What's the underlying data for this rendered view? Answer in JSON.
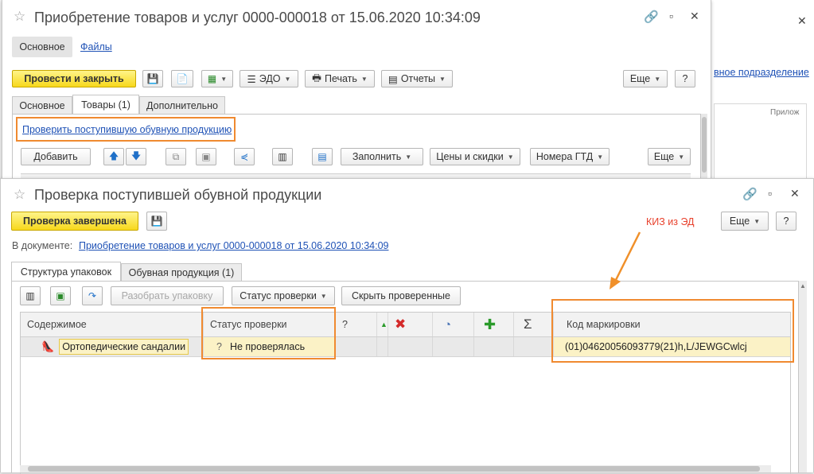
{
  "back_window": {
    "title": "Приобретение товаров и услуг 0000-000018 от 15.06.2020 10:34:09",
    "nav": {
      "main": "Основное",
      "files": "Файлы"
    },
    "toolbar": {
      "post_close": "Провести и закрыть",
      "edo": "ЭДО",
      "print": "Печать",
      "reports": "Отчеты",
      "more": "Еще",
      "help": "?"
    },
    "tabs": [
      "Основное",
      "Товары (1)",
      "Дополнительно"
    ],
    "check_link": "Проверить поступившую обувную продукцию",
    "goods_toolbar": {
      "add": "Добавить",
      "fill": "Заполнить",
      "prices": "Цены и скидки",
      "gtd": "Номера ГТД",
      "more": "Еще"
    }
  },
  "side_window": {
    "link_fragment": "вное подразделение",
    "column_fragment": "Прилож"
  },
  "front_window": {
    "title": "Проверка поступившей обувной продукции",
    "toolbar": {
      "done": "Проверка завершена",
      "more": "Еще",
      "help": "?"
    },
    "doc_label": "В документе:",
    "doc_link": "Приобретение товаров и услуг 0000-000018 от 15.06.2020 10:34:09",
    "tabs": [
      "Структура упаковок",
      "Обувная продукция (1)"
    ],
    "pack_toolbar": {
      "unpack": "Разобрать упаковку",
      "status": "Статус проверки",
      "hide": "Скрыть проверенные"
    },
    "table": {
      "headers": {
        "content": "Содержимое",
        "status": "Статус проверки",
        "q": "?",
        "sum": "Σ",
        "code": "Код маркировки"
      },
      "rows": [
        {
          "content": "Ортопедические сандалии",
          "status_icon": "?",
          "status": "Не проверялась",
          "code": "(01)04620056093779(21)h,L/JEWGCwlcj"
        }
      ]
    }
  },
  "annotation": {
    "text": "КИЗ из ЭД",
    "color": "#e8412c"
  },
  "colors": {
    "accent_yellow": "#f7d81c",
    "highlight_orange": "#f08a30",
    "link": "#1f52b6",
    "row_selected": "#fbf2c6"
  }
}
